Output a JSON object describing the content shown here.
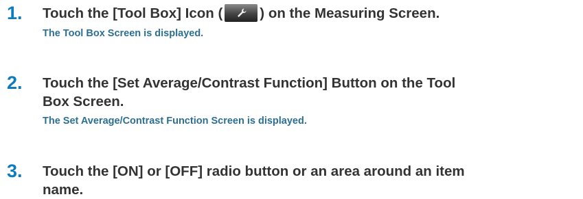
{
  "steps": [
    {
      "number": "1.",
      "text_before_icon": "Touch the [Tool Box] Icon (",
      "icon": "wrench-icon",
      "text_after_icon": ") on the Measuring Screen.",
      "result": "The Tool Box Screen is displayed."
    },
    {
      "number": "2.",
      "text_line1": "Touch the [Set Average/Contrast Function] Button on the Tool",
      "text_line2": "Box Screen.",
      "result": "The Set Average/Contrast Function Screen is displayed."
    },
    {
      "number": "3.",
      "text_line1": "Touch the [ON] or [OFF] radio button or an area around an item",
      "text_line2": "name."
    }
  ]
}
